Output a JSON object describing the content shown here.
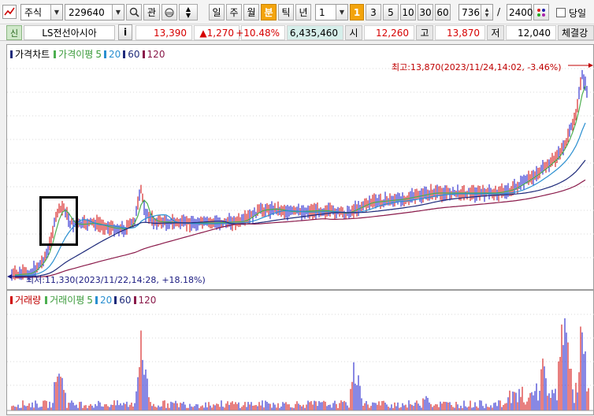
{
  "toolbar": {
    "market_select": "주식",
    "stock_code": "229640",
    "search_icon": "magnifier-icon",
    "btn_gwan": "관",
    "period_buttons": [
      "일",
      "주",
      "월",
      "분",
      "틱",
      "년"
    ],
    "active_period": "분",
    "interval_value": "1",
    "interval_buttons": [
      "1",
      "3",
      "5",
      "10",
      "30",
      "60"
    ],
    "active_interval": "1",
    "page_current": "736",
    "page_separator": "/",
    "page_total": "2400",
    "today_label": "당일"
  },
  "quote": {
    "badge": "신",
    "stock_name": "LS전선아시아",
    "info_button": "i",
    "price": "13,390",
    "change": "▲1,270",
    "change_pct": "+10.48%",
    "volume": "6,435,460",
    "open_label": "시",
    "open": "12,260",
    "high_label": "고",
    "high": "13,870",
    "low_label": "저",
    "low": "12,040",
    "settle_label": "체결강"
  },
  "price_panel": {
    "legend_title": "가격차트",
    "legend_ma_title": "가격이평",
    "ma_periods": [
      "5",
      "20",
      "60",
      "120"
    ],
    "high_annotation": "최고:13,870(2023/11/24,14:02, -3.46%)",
    "low_annotation": "최저:11,330(2023/11/22,14:28, +18.18%)"
  },
  "volume_panel": {
    "legend_title": "거래량",
    "legend_ma_title": "거래이평",
    "ma_periods": [
      "5",
      "20",
      "60",
      "120"
    ]
  },
  "colors": {
    "candle_up": "#d00000",
    "candle_down": "#1010c8",
    "ma5": "#4caf50",
    "ma20": "#2a8fd0",
    "ma60": "#1e2a7a",
    "ma120": "#8a1a4a",
    "accent_orange": "#f3a40c"
  }
}
